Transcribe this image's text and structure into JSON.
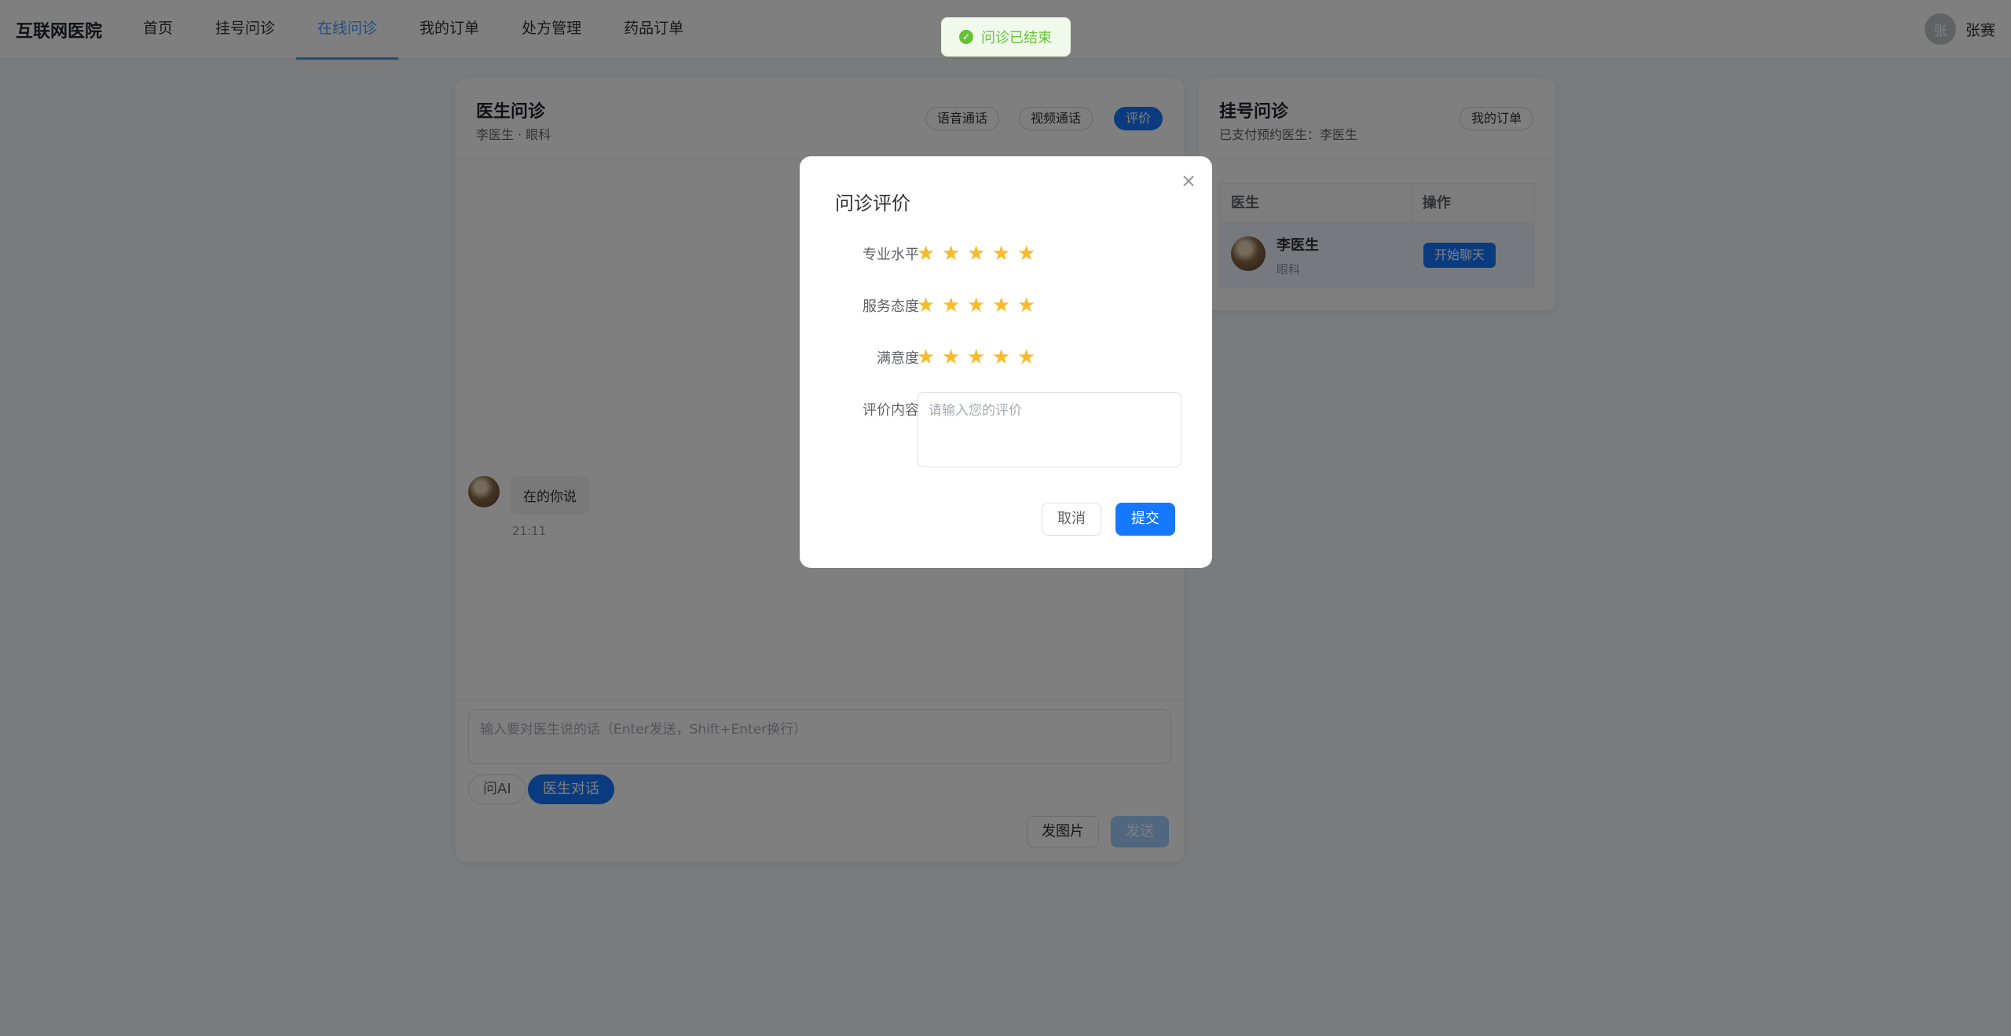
{
  "header": {
    "brand": "互联网医院",
    "nav": [
      {
        "label": "首页"
      },
      {
        "label": "挂号问诊"
      },
      {
        "label": "在线问诊"
      },
      {
        "label": "我的订单"
      },
      {
        "label": "处方管理"
      },
      {
        "label": "药品订单"
      }
    ],
    "active_nav": "在线问诊",
    "user": {
      "avatar_initial": "张",
      "name": "张赛"
    }
  },
  "chat": {
    "title": "医生问诊",
    "subtitle": "李医生 · 眼科",
    "buttons": {
      "voice": "语音通话",
      "video": "视频通话",
      "rate": "评价"
    },
    "messages": [
      {
        "text": "在的你说",
        "time": "21:11"
      }
    ],
    "input_placeholder": "输入要对医生说的话（Enter发送，Shift+Enter换行）",
    "modes": {
      "ai": "问AI",
      "doctor": "医生对话"
    },
    "send_image": "发图片",
    "send": "发送"
  },
  "registration": {
    "title": "挂号问诊",
    "subtitle": "已支付预约医生：李医生",
    "orders_button": "我的订单",
    "columns": [
      "医生",
      "操作"
    ],
    "rows": [
      {
        "name": "李医生",
        "dept": "眼科",
        "action": "开始聊天"
      }
    ]
  },
  "toast": {
    "text": "问诊已结束",
    "icon": "check-circle-icon"
  },
  "dialog": {
    "title": "问诊评价",
    "ratings": [
      {
        "label": "专业水平",
        "stars": 5,
        "max": 5
      },
      {
        "label": "服务态度",
        "stars": 5,
        "max": 5
      },
      {
        "label": "满意度",
        "stars": 5,
        "max": 5
      }
    ],
    "comment_label": "评价内容",
    "comment_placeholder": "请输入您的评价",
    "cancel": "取消",
    "submit": "提交"
  },
  "colors": {
    "primary": "#1677ff",
    "success": "#67c23a",
    "star": "#f7ba2a",
    "nav_active": "#409eff"
  }
}
